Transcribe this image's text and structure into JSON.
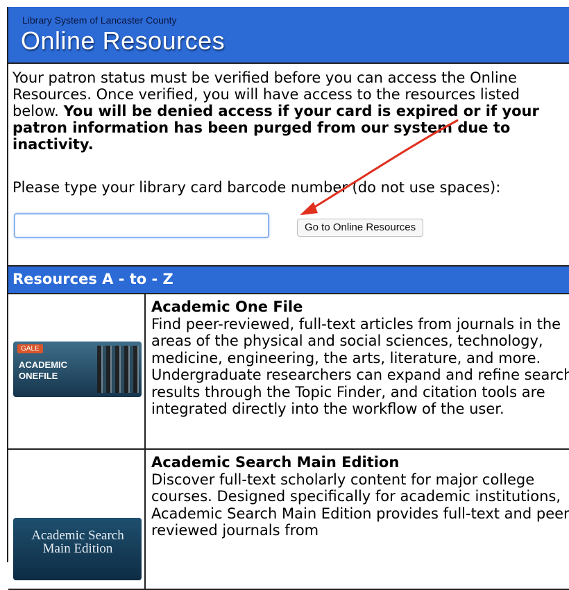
{
  "header": {
    "org": "Library System of Lancaster County",
    "title": "Online Resources"
  },
  "intro": {
    "normal": "Your patron status must be verified before you can access the Online Resources. Once verified, you will have access to the resources listed below.",
    "bold": "You will be denied access if your card is expired or if your patron information has been purged from our system due to inactivity."
  },
  "barcode": {
    "prompt": "Please type your library card barcode number (do not use spaces):",
    "value": "",
    "placeholder": ""
  },
  "go_button": "Go to Online Resources",
  "section": {
    "title": "Resources A - to - Z"
  },
  "resources": [
    {
      "name": "Academic One File",
      "description": "Find peer-reviewed, full-text articles from journals in the areas of the physical and social sciences, technology, medicine, engineering, the arts, literature, and more. Undergraduate researchers can expand and refine search results through the Topic Finder, and citation tools are integrated directly into the workflow of the user.",
      "logo_badge": "GALE",
      "logo_text": "ACADEMIC ONEFILE"
    },
    {
      "name": "Academic Search Main Edition",
      "description": "Discover full-text scholarly content for major college courses. Designed specifically for academic institutions, Academic Search Main Edition provides full-text and peer-reviewed journals from",
      "logo_text": "Academic Search Main Edition"
    }
  ],
  "colors": {
    "header_blue": "#2c6ad6",
    "annotation_arrow": "#e0301e"
  }
}
